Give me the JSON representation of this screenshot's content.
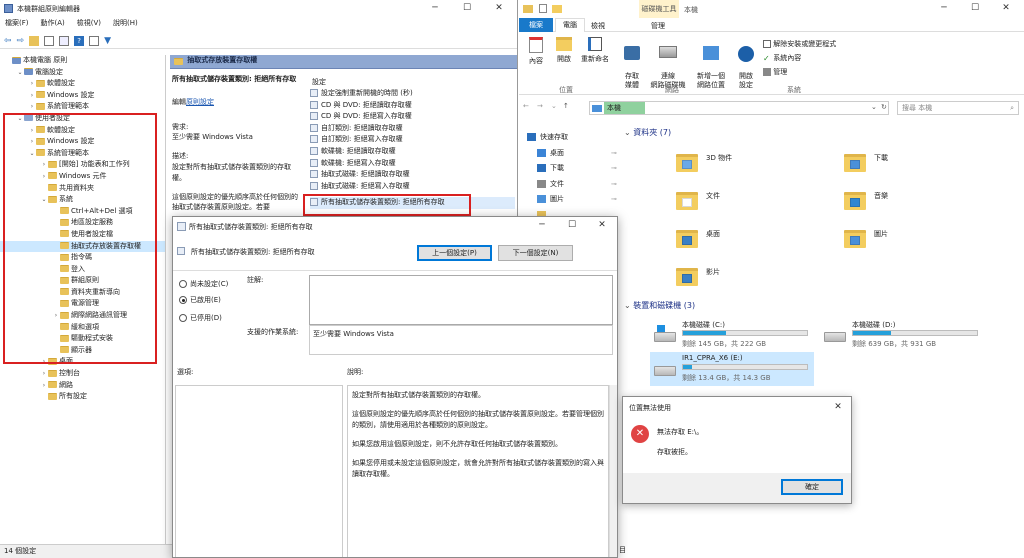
{
  "gpedit": {
    "title": "本機群組原則編輯器",
    "menu": [
      "檔案(F)",
      "動作(A)",
      "檢視(V)",
      "說明(H)"
    ],
    "tree": [
      {
        "t": "本機電腦 原則",
        "d": 0,
        "k": "pc"
      },
      {
        "t": "電腦設定",
        "d": 1,
        "k": "pc",
        "a": "v"
      },
      {
        "t": "軟體設定",
        "d": 2,
        "k": "f",
        "a": ">"
      },
      {
        "t": "Windows 設定",
        "d": 2,
        "k": "f",
        "a": ">"
      },
      {
        "t": "系統管理範本",
        "d": 2,
        "k": "f",
        "a": ">"
      },
      {
        "t": "使用者設定",
        "d": 1,
        "k": "u",
        "a": "v"
      },
      {
        "t": "軟體設定",
        "d": 2,
        "k": "f",
        "a": ">"
      },
      {
        "t": "Windows 設定",
        "d": 2,
        "k": "f",
        "a": ">"
      },
      {
        "t": "系統管理範本",
        "d": 2,
        "k": "f",
        "a": "v"
      },
      {
        "t": "[開始] 功能表和工作列",
        "d": 3,
        "k": "f",
        "a": ">"
      },
      {
        "t": "Windows 元件",
        "d": 3,
        "k": "f",
        "a": ">"
      },
      {
        "t": "共用資料夾",
        "d": 3,
        "k": "f",
        "a": ""
      },
      {
        "t": "系統",
        "d": 3,
        "k": "f",
        "a": "v"
      },
      {
        "t": "Ctrl+Alt+Del 選項",
        "d": 4,
        "k": "f",
        "a": ""
      },
      {
        "t": "地區設定服務",
        "d": 4,
        "k": "f",
        "a": ""
      },
      {
        "t": "使用者設定檔",
        "d": 4,
        "k": "f",
        "a": ""
      },
      {
        "t": "抽取式存放裝置存取權",
        "d": 4,
        "k": "f",
        "a": "",
        "sel": true
      },
      {
        "t": "指令碼",
        "d": 4,
        "k": "f",
        "a": ""
      },
      {
        "t": "登入",
        "d": 4,
        "k": "f",
        "a": ""
      },
      {
        "t": "群組原則",
        "d": 4,
        "k": "f",
        "a": ""
      },
      {
        "t": "資料夾重新導向",
        "d": 4,
        "k": "f",
        "a": ""
      },
      {
        "t": "電源管理",
        "d": 4,
        "k": "f",
        "a": ""
      },
      {
        "t": "網際網路通訊管理",
        "d": 4,
        "k": "f",
        "a": ">"
      },
      {
        "t": "緩和選項",
        "d": 4,
        "k": "f",
        "a": ""
      },
      {
        "t": "驅動程式安裝",
        "d": 4,
        "k": "f",
        "a": ""
      },
      {
        "t": "顯示器",
        "d": 4,
        "k": "f",
        "a": ""
      },
      {
        "t": "桌面",
        "d": 3,
        "k": "f",
        "a": ">"
      },
      {
        "t": "控制台",
        "d": 3,
        "k": "f",
        "a": ">"
      },
      {
        "t": "網路",
        "d": 3,
        "k": "f",
        "a": ">"
      },
      {
        "t": "所有設定",
        "d": 3,
        "k": "f",
        "a": ""
      }
    ],
    "section_header": "抽取式存放裝置存取權",
    "policy_title": "所有抽取式儲存裝置類別: 拒絕所有存取",
    "edit_prefix": "編輯",
    "edit_link": "原則設定",
    "req_label": "需求:",
    "req_value": "至少需要 Windows Vista",
    "desc_label": "描述:",
    "desc_value": "設定對所有抽取式儲存裝置類別的存取權。",
    "desc_more": "這個原則設定的優先順序高於任何個別的抽取式儲存裝置原則設定。若要",
    "settings_header": "設定",
    "settings": [
      "設定強制重新開機的時間 (秒)",
      "CD 與 DVD: 拒絕讀取存取權",
      "CD 與 DVD: 拒絕寫入存取權",
      "自訂類別: 拒絕讀取存取權",
      "自訂類別: 拒絕寫入存取權",
      "軟碟機: 拒絕讀取存取權",
      "軟碟機: 拒絕寫入存取權",
      "抽取式磁碟: 拒絕讀取存取權",
      "抽取式磁碟: 拒絕寫入存取權",
      "所有抽取式儲存裝置類別: 拒絕所有存取"
    ],
    "status": "14 個設定"
  },
  "dialog": {
    "title": "所有抽取式儲存裝置類別: 拒絕所有存取",
    "subtitle": "所有抽取式儲存裝置類別: 拒絕所有存取",
    "prev": "上一個設定(P)",
    "next": "下一個設定(N)",
    "opt_nc": "尚未設定(C)",
    "opt_en": "已啟用(E)",
    "opt_dis": "已停用(D)",
    "comment_label": "註解:",
    "support_label": "支援的作業系統:",
    "support_value": "至少需要 Windows Vista",
    "options_label": "選項:",
    "help_label": "說明:",
    "help": [
      "設定對所有抽取式儲存裝置類別的存取權。",
      "這個原則設定的優先順序高於任何個別的抽取式儲存裝置原則設定。若要管理個別的類別，請使用適用於各種類別的原則設定。",
      "如果您啟用這個原則設定，則不允許存取任何抽取式儲存裝置類別。",
      "如果您停用或未設定這個原則設定，就會允許對所有抽取式儲存裝置類別的寫入與讀取存取權。"
    ]
  },
  "explorer": {
    "ribbon_tabs": [
      "檔案",
      "電腦",
      "檢視"
    ],
    "drive_tools": "磁碟機工具",
    "manage": "管理",
    "this_pc": "本機",
    "ribbon_items": [
      "內容",
      "開啟",
      "重新命名",
      "存取\n媒體",
      "連線\n網路磁碟機",
      "新增一個\n網路位置",
      "開啟\n設定"
    ],
    "sys_items": [
      "解除安裝或變更程式",
      "系統內容",
      "管理"
    ],
    "group_labels": [
      "位置",
      "網路",
      "系統"
    ],
    "address": "本機",
    "search_ph": "搜尋 本機",
    "quick": [
      "快速存取",
      "桌面",
      "下載",
      "文件",
      "圖片",
      "",
      "",
      "",
      "",
      "",
      ""
    ],
    "folders_hdr": "資料夾 (7)",
    "folders": [
      "3D 物件",
      "下載",
      "文件",
      "音樂",
      "桌面",
      "圖片",
      "影片"
    ],
    "devices_hdr": "裝置和磁碟機 (3)",
    "drives": [
      {
        "name": "本機磁碟 (C:)",
        "free": "剩餘 145 GB，共 222 GB",
        "used": 0.35
      },
      {
        "name": "本機磁碟 (D:)",
        "free": "剩餘 639 GB，共 931 GB",
        "used": 0.31
      },
      {
        "name": "IR1_CPRA_X6 (E:)",
        "free": "剩餘 13.4 GB，共 14.3 GB",
        "used": 0.07
      }
    ],
    "status_suffix": "目"
  },
  "error": {
    "title": "位置無法使用",
    "line1": "無法存取 E:\\。",
    "line2": "存取被拒。",
    "ok": "確定"
  }
}
